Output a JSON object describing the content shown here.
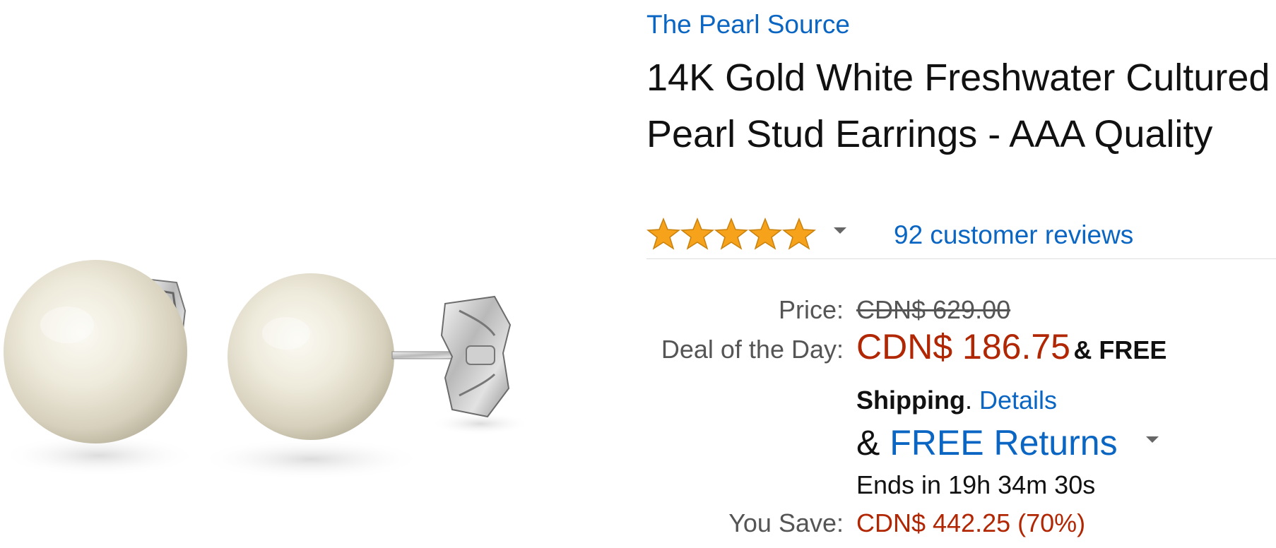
{
  "brand": {
    "name": "The Pearl Source"
  },
  "product": {
    "title": "14K Gold White Freshwater Cultured Pearl Stud Earrings - AAA Quality",
    "image_icon": "pearl-earrings-image"
  },
  "rating": {
    "stars": 5,
    "max_stars": 5,
    "reviews_text": "92 customer reviews",
    "star_color": "#f7a21b"
  },
  "pricing": {
    "price_label": "Price:",
    "list_price": "CDN$ 629.00",
    "deal_label": "Deal of the Day:",
    "deal_price": "CDN$ 186.75",
    "amp_free": "& FREE",
    "shipping": "Shipping",
    "shipping_period": ".",
    "details": "Details",
    "returns_amp": "& ",
    "returns": "FREE Returns",
    "ends": "Ends in 19h 34m 30s",
    "save_label": "You Save:",
    "save_value": "CDN$ 442.25 (70%)"
  },
  "colors": {
    "link": "#0a66c2",
    "price": "#b12704",
    "label": "#555555"
  }
}
